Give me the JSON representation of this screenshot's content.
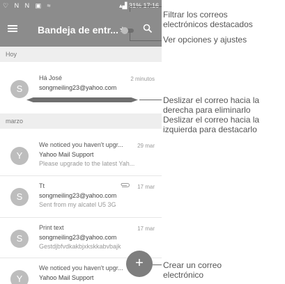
{
  "status_bar": {
    "left_icons": "♡ N N ▣ ≈",
    "battery": "31%",
    "time": "17:16"
  },
  "app_bar": {
    "title": "Bandeja de entr..."
  },
  "sections": {
    "today": "Hoy",
    "march": "marzo"
  },
  "mails": [
    {
      "avatar": "S",
      "sender": "Há José",
      "subject": "songmeiling23@yahoo.com",
      "preview": "",
      "date": "2 minutos"
    },
    {
      "avatar": "Y",
      "sender": "We noticed you haven't upgr...",
      "subject": "Yahoo Mail Support",
      "preview": "Please upgrade to the latest Yah...",
      "date": "29 mar"
    },
    {
      "avatar": "S",
      "sender": "Tt",
      "subject": "songmeiling23@yahoo.com",
      "preview": "Sent from my alcatel U5 3G",
      "date": "17 mar"
    },
    {
      "avatar": "S",
      "sender": "Print text",
      "subject": "songmeiling23@yahoo.com",
      "preview": "Gestdjbfvdkakbjxkskkabvbajk",
      "date": "17 mar"
    },
    {
      "avatar": "Y",
      "sender": "We noticed you haven't upgr...",
      "subject": "Yahoo Mail Support",
      "preview": "",
      "date": ""
    }
  ],
  "fab_label": "+",
  "callouts": {
    "starred_filter": [
      "Filtrar los correos",
      "electrónicos destacados"
    ],
    "options": "Ver opciones y ajustes",
    "swipe": [
      "Deslizar el correo hacia la",
      "derecha para eliminarlo",
      "Deslizar el correo hacia la",
      "izquierda para destacarlo"
    ],
    "compose": [
      "Crear un correo",
      "electrónico"
    ]
  }
}
